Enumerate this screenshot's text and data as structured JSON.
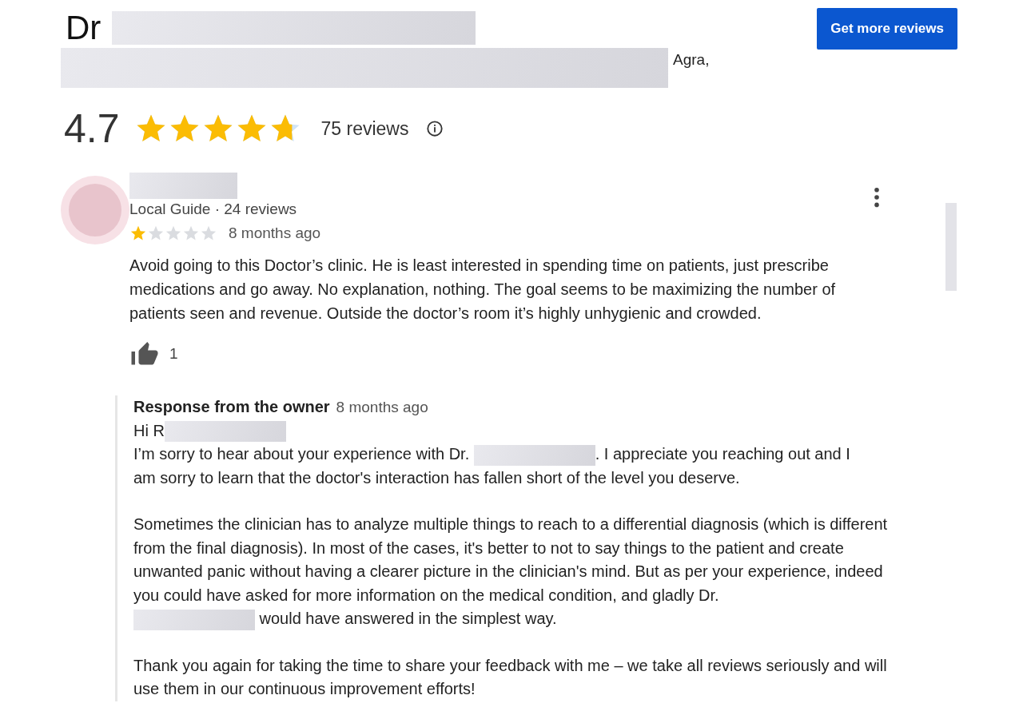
{
  "header": {
    "title": "Dr",
    "address_suffix": "Agra,",
    "action": "Get more reviews"
  },
  "summary": {
    "rating": "4.7",
    "stars": 4.7,
    "count": "75 reviews"
  },
  "review": {
    "meta": "Local Guide · 24 reviews",
    "stars": 1,
    "time": "8 months ago",
    "text": "Avoid going to this Doctor’s clinic. He is least interested in spending time on patients, just prescribe medications and go away. No explanation, nothing. The goal seems to be maximizing the number of patients seen and revenue. Outside the doctor’s room it’s highly unhygienic and crowded.",
    "likes": "1"
  },
  "response": {
    "label": "Response from the owner",
    "time": "8 months ago",
    "paragraphs": [
      [
        {
          "kind": "text",
          "text": "Hi R"
        },
        {
          "kind": "redacted"
        },
        {
          "kind": "break"
        },
        {
          "kind": "text",
          "text": "I’m sorry to hear about your experience with Dr. "
        },
        {
          "kind": "redacted"
        },
        {
          "kind": "text",
          "text": ". I appreciate you reaching out and I"
        },
        {
          "kind": "break"
        },
        {
          "kind": "text",
          "text": "am sorry to learn that the doctor's interaction has fallen short of the level you deserve."
        }
      ],
      [
        {
          "kind": "text",
          "text": "Sometimes the clinician has to analyze multiple things to reach to a differential diagnosis (which is different from the final diagnosis). In most of the cases, it's better to not to say things to the patient and create unwanted panic without having a clearer picture in the clinician's mind. But as per your experience, indeed you could have asked for more information on the medical condition, and gladly Dr."
        },
        {
          "kind": "redacted"
        },
        {
          "kind": "text",
          "text": " would have answered in the simplest way."
        }
      ],
      [
        {
          "kind": "text",
          "text": "Thank you again for taking the time to share your feedback with me – we take all reviews seriously and will use them in our continuous improvement efforts!"
        }
      ]
    ]
  }
}
